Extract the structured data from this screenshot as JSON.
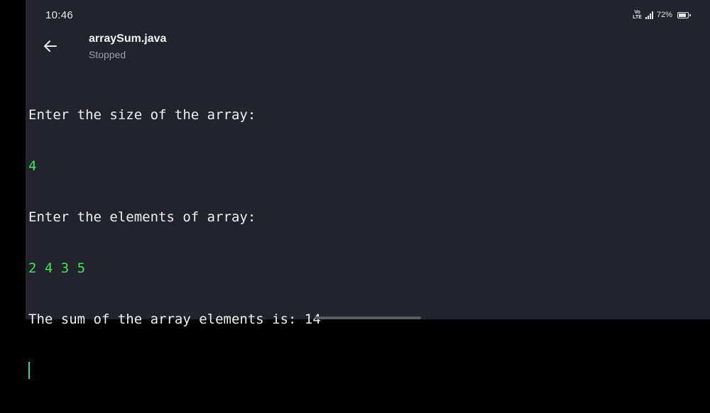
{
  "status_bar": {
    "time": "10:46",
    "volte_top": "Vo",
    "volte_bottom": "LTE",
    "battery_percent": "72%",
    "battery_level": 0.72
  },
  "toolbar": {
    "title": "arraySum.java",
    "status": "Stopped",
    "back_icon": "arrow-left-icon"
  },
  "console": {
    "lines": [
      {
        "kind": "out",
        "text": "Enter the size of the array:"
      },
      {
        "kind": "in",
        "text": "4"
      },
      {
        "kind": "out",
        "text": "Enter the elements of array:"
      },
      {
        "kind": "in",
        "text": "2 4 3 5"
      },
      {
        "kind": "out",
        "text": "The sum of the array elements is: 14"
      }
    ]
  },
  "colors": {
    "background": "#22232c",
    "output_text": "#f0f0f0",
    "input_text": "#3ee65c",
    "cursor": "#3fd3a0"
  }
}
